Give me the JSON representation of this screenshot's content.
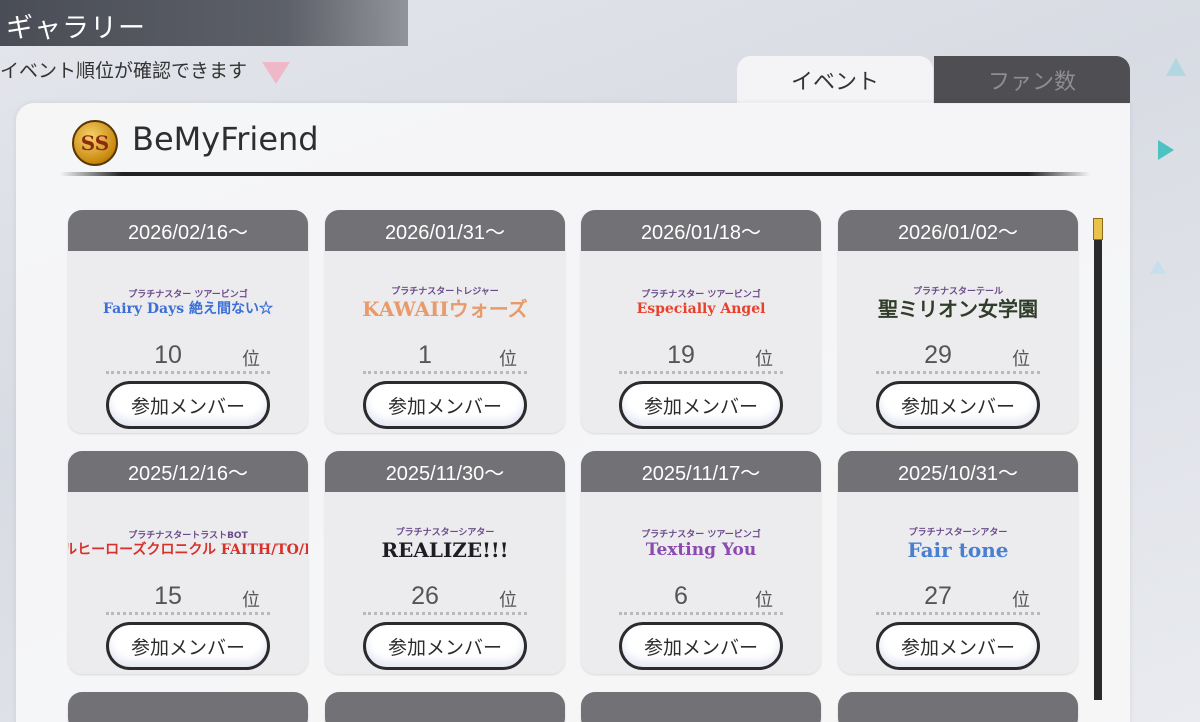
{
  "header": {
    "title": "ギャラリー",
    "subtitle": "イベント順位が確認できます"
  },
  "tabs": [
    {
      "label": "イベント",
      "active": true
    },
    {
      "label": "ファン数",
      "active": false
    }
  ],
  "group": {
    "badge": "SS",
    "name": "BeMyFriend"
  },
  "rank_unit": "位",
  "member_button_label": "参加メンバー",
  "events": [
    {
      "date": "2026/02/16〜",
      "rank": "10",
      "logo_sub": "プラチナスター ツアービンゴ",
      "logo_main": "Fairy Days 絶え間ない☆",
      "color": "#3b6fd8"
    },
    {
      "date": "2026/01/31〜",
      "rank": "1",
      "logo_sub": "プラチナスタートレジャー",
      "logo_main": "KAWAIIウォーズ",
      "color": "#e89a6a"
    },
    {
      "date": "2026/01/18〜",
      "rank": "19",
      "logo_sub": "プラチナスター ツアービンゴ",
      "logo_main": "Especially Angel",
      "color": "#e8402a"
    },
    {
      "date": "2026/01/02〜",
      "rank": "29",
      "logo_sub": "プラチナスターテール",
      "logo_main": "聖ミリオン女学園",
      "color": "#2f3d2a"
    },
    {
      "date": "2025/12/16〜",
      "rank": "15",
      "logo_sub": "プラチナスタートラストBOT",
      "logo_main": "アイドルヒーローズクロニクル FAITH/TO/FAITH",
      "color": "#d8302a"
    },
    {
      "date": "2025/11/30〜",
      "rank": "26",
      "logo_sub": "プラチナスターシアター",
      "logo_main": "REALIZE!!!",
      "color": "#1d1d22"
    },
    {
      "date": "2025/11/17〜",
      "rank": "6",
      "logo_sub": "プラチナスター ツアービンゴ",
      "logo_main": "Texting You",
      "color": "#8a4ab0"
    },
    {
      "date": "2025/10/31〜",
      "rank": "27",
      "logo_sub": "プラチナスターシアター",
      "logo_main": "Fair tone",
      "color": "#4a7fd0"
    }
  ],
  "colors": {
    "header_bg": "#4a4d56",
    "date_bar": "#727276",
    "tab_inactive": "#4f4f53",
    "scroll_thumb": "#e8c24a"
  }
}
